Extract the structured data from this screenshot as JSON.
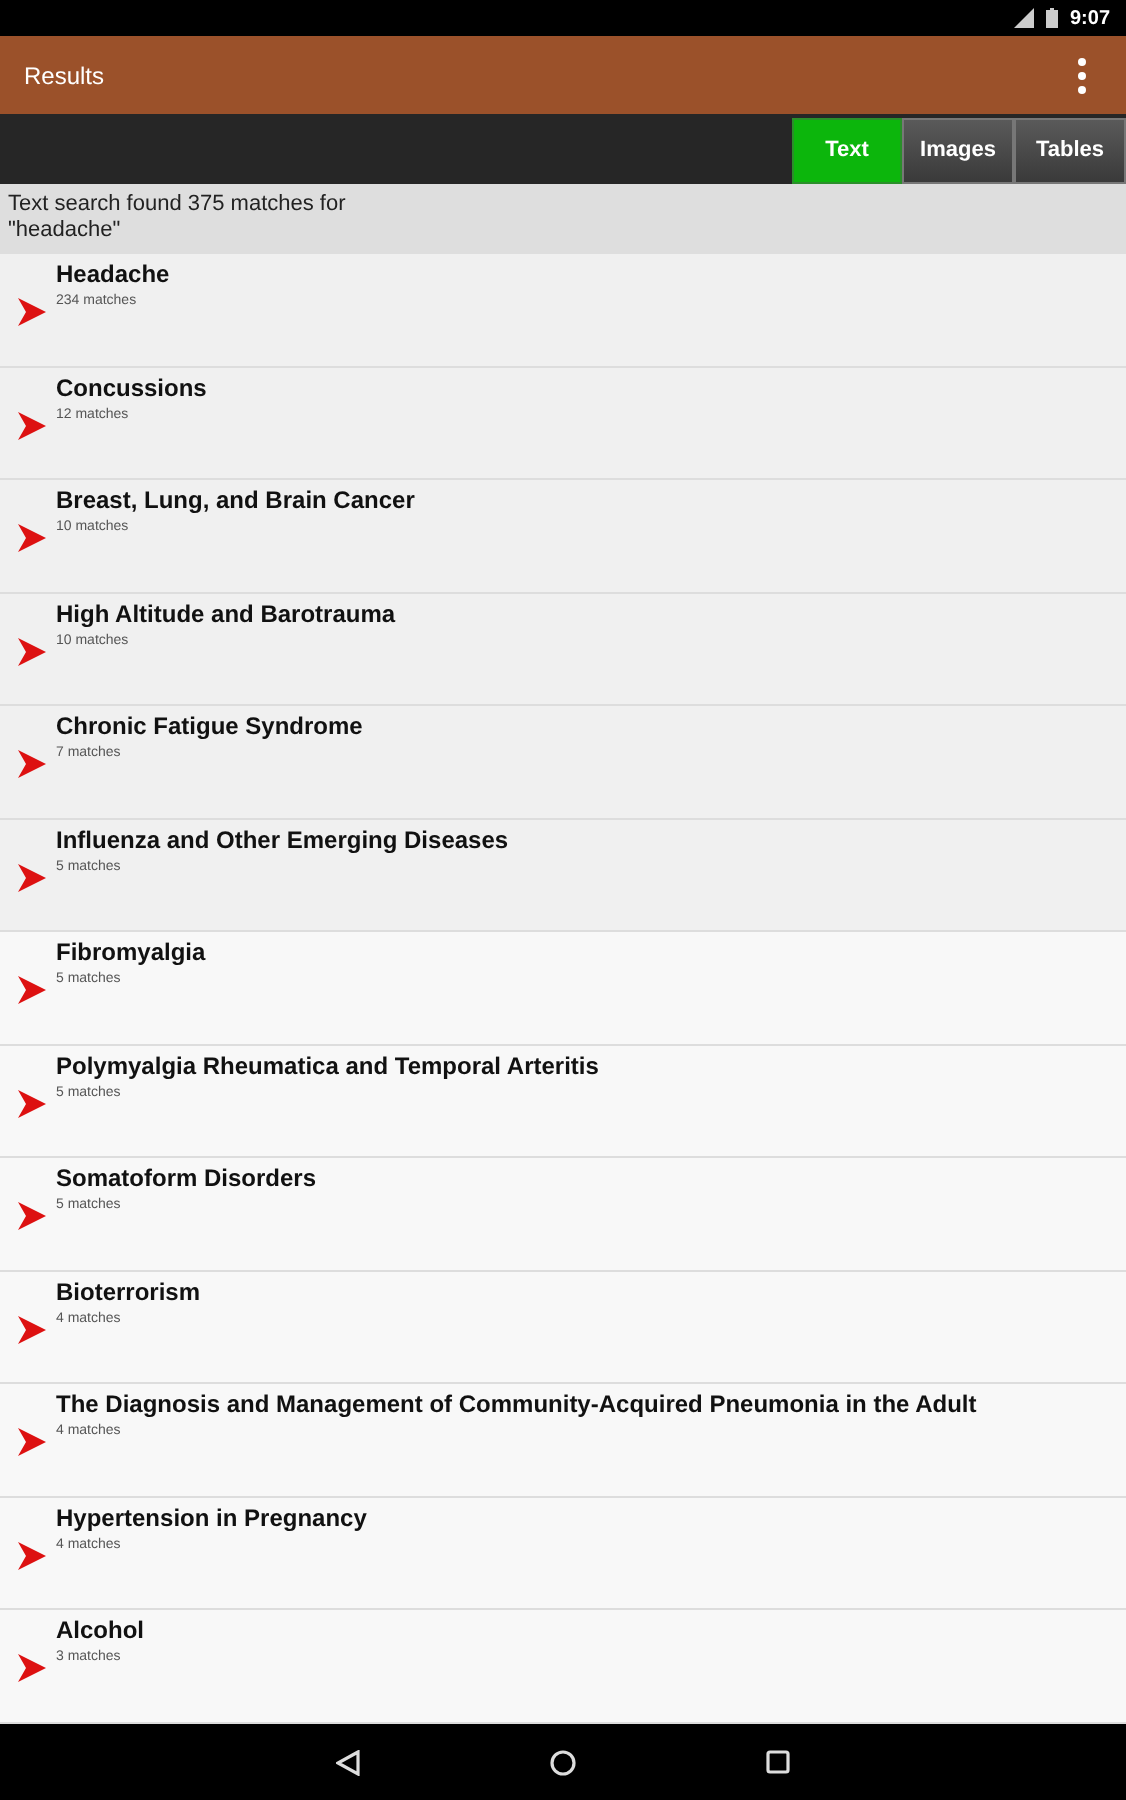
{
  "status_bar": {
    "time": "9:07"
  },
  "app_bar": {
    "title": "Results"
  },
  "tabs": [
    {
      "label": "Text",
      "selected": true
    },
    {
      "label": "Images",
      "selected": false
    },
    {
      "label": "Tables",
      "selected": false
    }
  ],
  "summary": "Text search found 375 matches for \"headache\"",
  "results": [
    {
      "title": "Headache",
      "matches": "234 matches"
    },
    {
      "title": "Concussions",
      "matches": "12 matches"
    },
    {
      "title": "Breast, Lung, and Brain Cancer",
      "matches": "10 matches"
    },
    {
      "title": "High Altitude and Barotrauma",
      "matches": "10 matches"
    },
    {
      "title": "Chronic Fatigue Syndrome",
      "matches": "7 matches"
    },
    {
      "title": "Influenza and Other Emerging Diseases",
      "matches": "5 matches"
    },
    {
      "title": "Fibromyalgia",
      "matches": "5 matches"
    },
    {
      "title": "Polymyalgia Rheumatica and Temporal Arteritis",
      "matches": "5 matches"
    },
    {
      "title": "Somatoform Disorders",
      "matches": "5 matches"
    },
    {
      "title": "Bioterrorism",
      "matches": "4 matches"
    },
    {
      "title": "The Diagnosis and Management of Community-Acquired Pneumonia in the Adult",
      "matches": "4 matches"
    },
    {
      "title": "Hypertension in Pregnancy",
      "matches": "4 matches"
    },
    {
      "title": "Alcohol",
      "matches": "3 matches"
    }
  ]
}
